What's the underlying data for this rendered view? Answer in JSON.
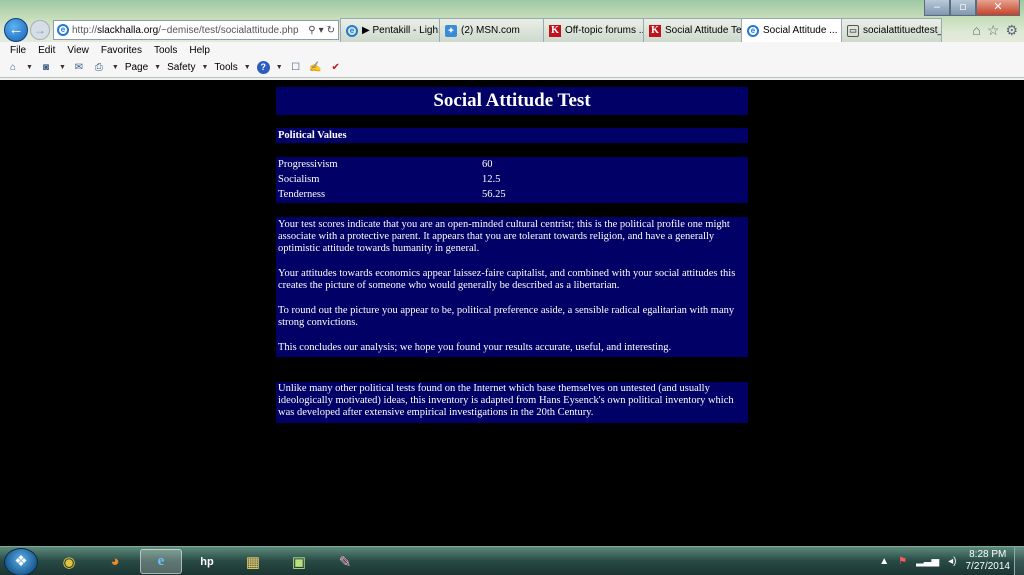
{
  "window": {
    "minimize_glyph": "‒",
    "maximize_glyph": "▫",
    "close_glyph": "✕"
  },
  "nav": {
    "back_glyph": "←",
    "forward_glyph": "→"
  },
  "address": {
    "prefix": "http://",
    "host": "slackhalla.org",
    "path": "/~demise/test/socialattitude.php",
    "search_glyph": "⚲",
    "dropdown_glyph": "▾",
    "refresh_glyph": "↻"
  },
  "tabs": [
    {
      "label": "▶ Pentakill - Ligh...",
      "icon": "ie-page-icon"
    },
    {
      "label": "(2) MSN.com",
      "icon": "msn-icon"
    },
    {
      "label": "Off-topic forums ...",
      "icon": "k-site-icon"
    },
    {
      "label": "Social Attitude Te...",
      "icon": "k-site-icon"
    },
    {
      "label": "Social Attitude ...",
      "icon": "ie-page-icon",
      "active": true,
      "close": "×"
    },
    {
      "label": "socialattituedtest_...",
      "icon": "tab-page-icon"
    }
  ],
  "chrome_right": {
    "home_glyph": "⌂",
    "favorites_glyph": "☆",
    "settings_glyph": "⚙"
  },
  "menubar": [
    "File",
    "Edit",
    "View",
    "Favorites",
    "Tools",
    "Help"
  ],
  "commandbar": {
    "page_label": "Page",
    "safety_label": "Safety",
    "tools_label": "Tools",
    "help_glyph": "?"
  },
  "content": {
    "title": "Social Attitude Test",
    "section": "Political Values",
    "scores": [
      {
        "label": "Progressivism",
        "value": "60"
      },
      {
        "label": "Socialism",
        "value": "12.5"
      },
      {
        "label": "Tenderness",
        "value": "56.25"
      }
    ],
    "analysis": [
      "Your test scores indicate that you are an open-minded cultural centrist; this is the political profile one might associate with a protective parent. It appears that you are tolerant towards religion, and have a generally optimistic attitude towards humanity in general.",
      "Your attitudes towards economics appear laissez-faire capitalist, and combined with your social attitudes this creates the picture of someone who would generally be described as a libertarian.",
      "To round out the picture you appear to be, political preference aside, a sensible radical egalitarian with many strong convictions.",
      "This concludes our analysis; we hope you found your results accurate, useful, and interesting."
    ],
    "note": "Unlike many other political tests found on the Internet which base themselves on untested (and usually ideologically motivated) ideas, this inventory is adapted from Hans Eysenck's own political inventory which was developed after extensive empirical investigations in the 20th Century."
  },
  "taskbar": {
    "clock_time": "8:28 PM",
    "clock_date": "7/27/2014"
  },
  "colors": {
    "content_box": "#000066",
    "page_background": "#000000"
  }
}
